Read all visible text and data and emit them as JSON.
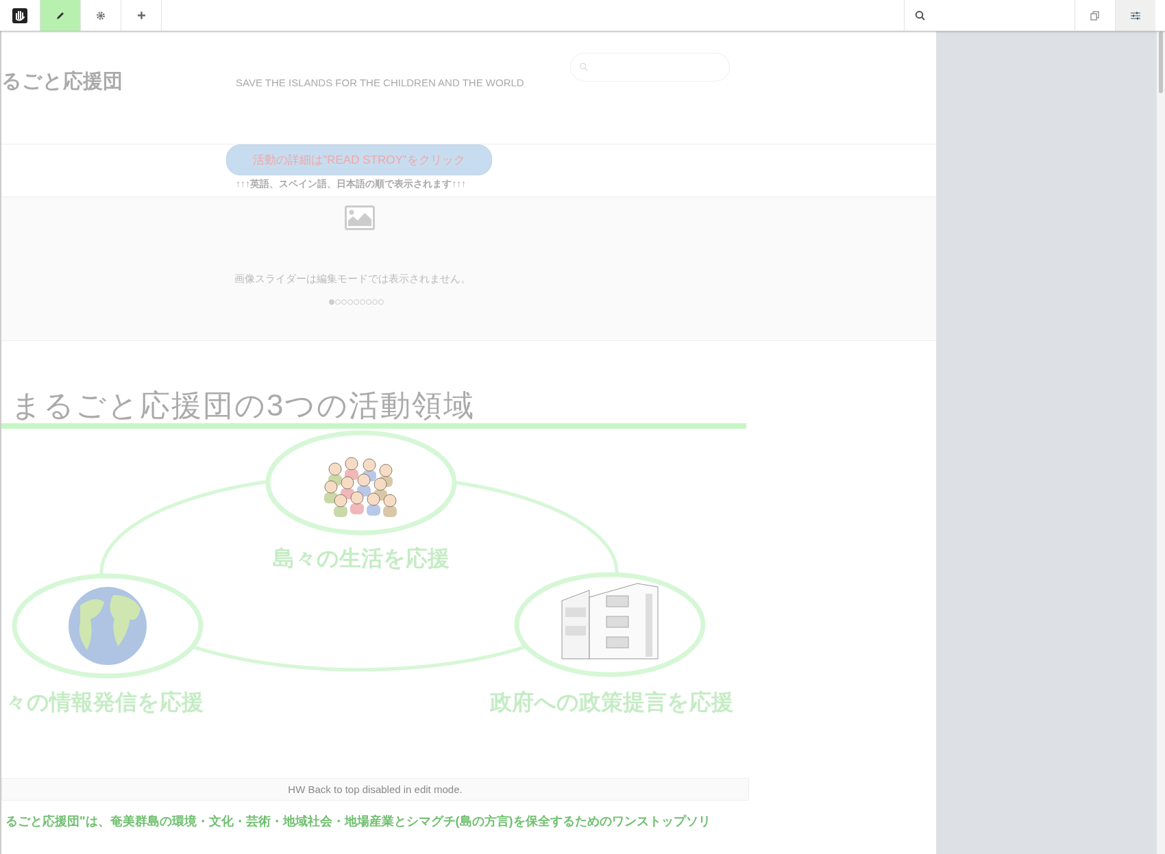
{
  "toolbar": {
    "left_buttons": [
      {
        "kind": "logo",
        "selected": false
      },
      {
        "kind": "edit",
        "selected": true
      },
      {
        "kind": "settings",
        "selected": false
      },
      {
        "kind": "add",
        "selected": false
      }
    ],
    "right_buttons": [
      {
        "kind": "pages",
        "selected": false
      },
      {
        "kind": "options",
        "selected": true
      }
    ]
  },
  "header": {
    "site_title": "るごと応援団",
    "tagline": "SAVE THE ISLANDS FOR THE CHILDREN AND THE WORLD"
  },
  "notice": {
    "button": "活動の詳細は\"READ STROY\"をクリック",
    "note": "↑↑↑英語、スペイン語、日本語の順で表示されます↑↑↑"
  },
  "slider": {
    "message": "画像スライダーは編集モードでは表示されません。",
    "dots": [
      {
        "selected": true
      },
      {
        "selected": false
      },
      {
        "selected": false
      },
      {
        "selected": false
      },
      {
        "selected": false
      },
      {
        "selected": false
      },
      {
        "selected": false
      },
      {
        "selected": false
      },
      {
        "selected": false
      }
    ]
  },
  "section": {
    "heading": "まるごと応援団の3つの活動領域",
    "nodes": [
      {
        "kind": "people",
        "label": "島々の生活を応援"
      },
      {
        "kind": "globe",
        "label": "々の情報発信を応援"
      },
      {
        "kind": "building",
        "label": "政府への政策提言を応援"
      }
    ]
  },
  "footer": {
    "back_to_top": "HW Back to top disabled in edit mode.",
    "description": "るごと応援団\"は、奄美群島の環境・文化・芸術・地域社会・地場産業とシマグチ(島の方言)を保全するためのワンストップソリ"
  }
}
